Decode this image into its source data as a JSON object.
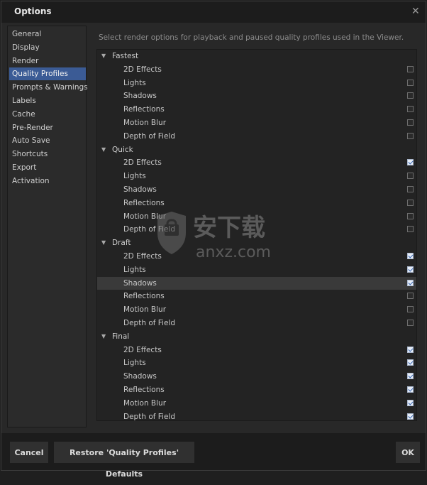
{
  "window": {
    "title": "Options"
  },
  "sidebar": {
    "items": [
      {
        "label": "General",
        "active": false
      },
      {
        "label": "Display",
        "active": false
      },
      {
        "label": "Render",
        "active": false
      },
      {
        "label": "Quality Profiles",
        "active": true
      },
      {
        "label": "Prompts & Warnings",
        "active": false
      },
      {
        "label": "Labels",
        "active": false
      },
      {
        "label": "Cache",
        "active": false
      },
      {
        "label": "Pre-Render",
        "active": false
      },
      {
        "label": "Auto Save",
        "active": false
      },
      {
        "label": "Shortcuts",
        "active": false
      },
      {
        "label": "Export",
        "active": false
      },
      {
        "label": "Activation",
        "active": false
      }
    ]
  },
  "main": {
    "description": "Select render options for playback and paused quality profiles used in the Viewer.",
    "groups": [
      {
        "name": "Fastest",
        "options": [
          {
            "label": "2D Effects",
            "checked": false
          },
          {
            "label": "Lights",
            "checked": false
          },
          {
            "label": "Shadows",
            "checked": false
          },
          {
            "label": "Reflections",
            "checked": false
          },
          {
            "label": "Motion Blur",
            "checked": false
          },
          {
            "label": "Depth of Field",
            "checked": false
          }
        ]
      },
      {
        "name": "Quick",
        "options": [
          {
            "label": "2D Effects",
            "checked": true
          },
          {
            "label": "Lights",
            "checked": false
          },
          {
            "label": "Shadows",
            "checked": false
          },
          {
            "label": "Reflections",
            "checked": false
          },
          {
            "label": "Motion Blur",
            "checked": false
          },
          {
            "label": "Depth of Field",
            "checked": false
          }
        ]
      },
      {
        "name": "Draft",
        "options": [
          {
            "label": "2D Effects",
            "checked": true
          },
          {
            "label": "Lights",
            "checked": true
          },
          {
            "label": "Shadows",
            "checked": true,
            "highlighted": true
          },
          {
            "label": "Reflections",
            "checked": false
          },
          {
            "label": "Motion Blur",
            "checked": false
          },
          {
            "label": "Depth of Field",
            "checked": false
          }
        ]
      },
      {
        "name": "Final",
        "options": [
          {
            "label": "2D Effects",
            "checked": true
          },
          {
            "label": "Lights",
            "checked": true
          },
          {
            "label": "Shadows",
            "checked": true
          },
          {
            "label": "Reflections",
            "checked": true
          },
          {
            "label": "Motion Blur",
            "checked": true
          },
          {
            "label": "Depth of Field",
            "checked": true
          }
        ]
      }
    ]
  },
  "footer": {
    "cancel_label": "Cancel",
    "restore_label": "Restore 'Quality Profiles' Defaults",
    "ok_label": "OK"
  },
  "watermark": {
    "text_cn": "安下载",
    "text_en": "anxz.com"
  },
  "icons": {
    "close": "close-icon",
    "expand": "chevron-down-icon",
    "watermark": "shield-logo-icon"
  },
  "colors": {
    "accent": "#3b5b95",
    "checkbox_check": "#3060b0"
  }
}
